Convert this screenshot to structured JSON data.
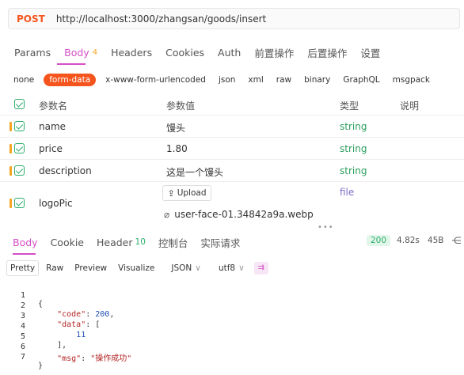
{
  "request": {
    "method": "POST",
    "url": "http://localhost:3000/zhangsan/goods/insert"
  },
  "req_tabs": [
    {
      "label": "Params"
    },
    {
      "label": "Body",
      "count": "4",
      "active": true
    },
    {
      "label": "Headers"
    },
    {
      "label": "Cookies"
    },
    {
      "label": "Auth"
    },
    {
      "label": "前置操作"
    },
    {
      "label": "后置操作"
    },
    {
      "label": "设置"
    }
  ],
  "body_types": [
    "none",
    "form-data",
    "x-www-form-urlencoded",
    "json",
    "xml",
    "raw",
    "binary",
    "GraphQL",
    "msgpack"
  ],
  "body_type_active": "form-data",
  "params_table": {
    "headers": {
      "key": "参数名",
      "value": "参数值",
      "type": "类型",
      "desc": "说明"
    },
    "rows": [
      {
        "key": "name",
        "value": "馒头",
        "type": "string"
      },
      {
        "key": "price",
        "value": "1.80",
        "type": "string"
      },
      {
        "key": "description",
        "value": "这是一个馒头",
        "type": "string"
      },
      {
        "key": "logoPic",
        "upload_label": "Upload",
        "file_name": "user-face-01.34842a9a.webp",
        "type": "file"
      }
    ]
  },
  "splitter": "•••",
  "res_tabs": [
    {
      "label": "Body",
      "active": true
    },
    {
      "label": "Cookie"
    },
    {
      "label": "Header",
      "count": "10"
    },
    {
      "label": "控制台"
    },
    {
      "label": "实际请求"
    }
  ],
  "res_meta": {
    "status": "200",
    "time": "4.82s",
    "size": "45B"
  },
  "view_tabs": [
    "Pretty",
    "Raw",
    "Preview",
    "Visualize"
  ],
  "view_select": {
    "format": "JSON",
    "encoding": "utf8"
  },
  "code_lines": [
    {
      "num": "1"
    },
    {
      "num": "2"
    },
    {
      "num": "3"
    },
    {
      "num": "4"
    },
    {
      "num": "5"
    },
    {
      "num": "6"
    },
    {
      "num": "7"
    }
  ],
  "response_json": {
    "code_key": "\"code\"",
    "code_val": "200",
    "data_key": "\"data\"",
    "data_item": "11",
    "msg_key": "\"msg\"",
    "msg_val": "\"操作成功\""
  },
  "colors": {
    "accent": "#d54ec7",
    "method": "#f5541d",
    "string_type": "#2c9e5d",
    "status_bg": "#e3f6ea"
  }
}
